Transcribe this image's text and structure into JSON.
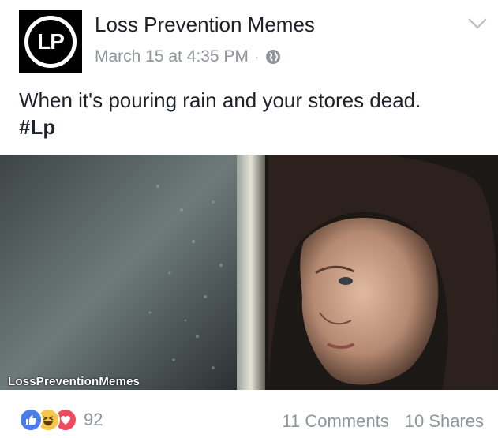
{
  "post": {
    "page_name": "Loss Prevention Memes",
    "avatar_text": "LP",
    "timestamp": "March 15 at 4:35 PM",
    "separator": "·",
    "privacy_icon": "globe-icon",
    "menu_icon": "chevron-down-icon",
    "text": "When it's pouring rain and your stores dead.",
    "hashtag": "#Lp",
    "image_watermark": "LossPreventionMemes"
  },
  "footer": {
    "reaction_icons": [
      "like-icon",
      "haha-icon",
      "love-icon"
    ],
    "reaction_count": "92",
    "comments": "11 Comments",
    "shares": "10 Shares"
  },
  "colors": {
    "text": "#1d2129",
    "meta": "#90949c",
    "like": "#4a7de8",
    "haha": "#f7c74b",
    "love": "#f04a5e"
  }
}
